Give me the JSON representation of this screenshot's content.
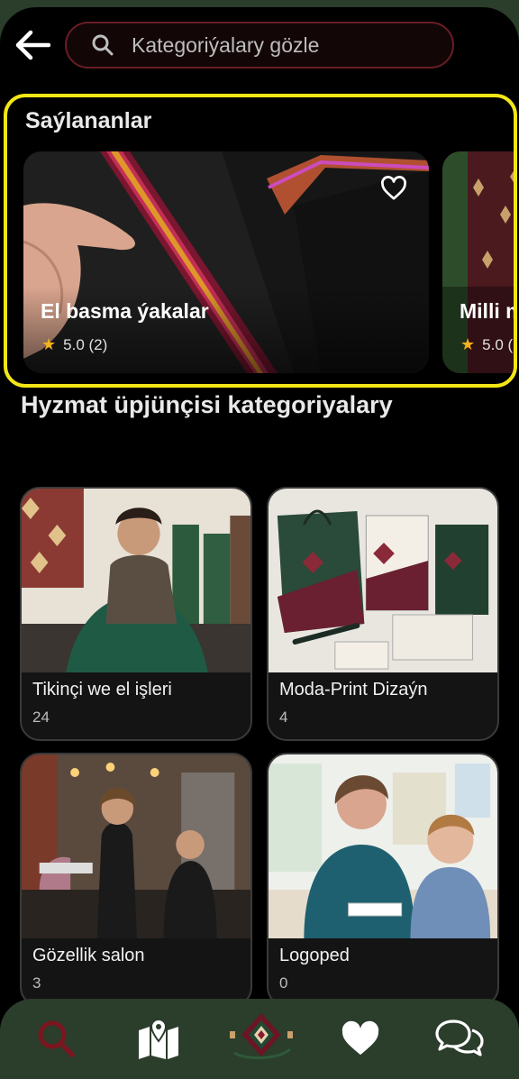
{
  "search": {
    "placeholder": "Kategoriýalary gözle"
  },
  "featured": {
    "title": "Saýlananlar",
    "items": [
      {
        "name": "El basma ýakalar",
        "rating": "5.0 (2)"
      },
      {
        "name": "Milli m",
        "rating": "5.0 ("
      }
    ]
  },
  "categories_section": {
    "title": "Hyzmat üpjünçisi kategoriyalary",
    "items": [
      {
        "name": "Tikinçi we el işleri",
        "count": "24"
      },
      {
        "name": "Moda-Print Dizaýn",
        "count": "4"
      },
      {
        "name": "Gözellik salon",
        "count": "3"
      },
      {
        "name": "Logoped",
        "count": "0"
      }
    ]
  },
  "colors": {
    "accent_yellow": "#f3e616",
    "nav_bg": "#2b3d2b",
    "active_icon": "#7a1620",
    "star": "#f5b21a"
  },
  "icons": [
    "back-arrow-icon",
    "search-icon",
    "heart-outline-icon",
    "star-icon",
    "map-icon",
    "logo-icon",
    "heart-icon",
    "chat-icon"
  ]
}
